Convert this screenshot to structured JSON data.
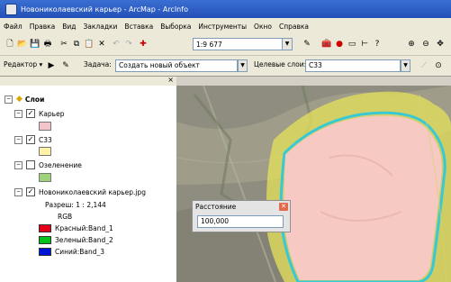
{
  "window": {
    "title": "Новониколаевский карьер - ArcMap - ArcInfo"
  },
  "menu": [
    "Файл",
    "Правка",
    "Вид",
    "Закладки",
    "Вставка",
    "Выборка",
    "Инструменты",
    "Окно",
    "Справка"
  ],
  "toolbar": {
    "scale_value": "1:9 677",
    "editor_label": "Редактор ▾",
    "task_label": "Задача:",
    "task_value": "Создать новый объект",
    "target_label": "Целевые слои:",
    "target_value": "С33"
  },
  "toc": {
    "root_label": "Слои",
    "layers": [
      {
        "name": "Карьер",
        "checked": true,
        "color": "#f3c5cb"
      },
      {
        "name": "С33",
        "checked": true,
        "color": "#fff1a8"
      },
      {
        "name": "Озеленение",
        "checked": false,
        "color": "#9fd27a"
      },
      {
        "name": "Новониколаевский карьер.jpg",
        "checked": true
      }
    ],
    "raster": {
      "resolution": "Разреш: 1 : 2,144",
      "mode": "RGB",
      "bands": [
        {
          "label": "Красный:Band_1",
          "color": "#e4001b"
        },
        {
          "label": "Зеленый:Band_2",
          "color": "#00c21b"
        },
        {
          "label": "Синий:Band_3",
          "color": "#0014d8"
        }
      ]
    }
  },
  "dialog": {
    "title": "Расстояние",
    "value": "100,000"
  },
  "colors": {
    "zone_fill": "#f6c9c3",
    "buffer": "#e4e25a",
    "outline": "#37c9d6"
  }
}
